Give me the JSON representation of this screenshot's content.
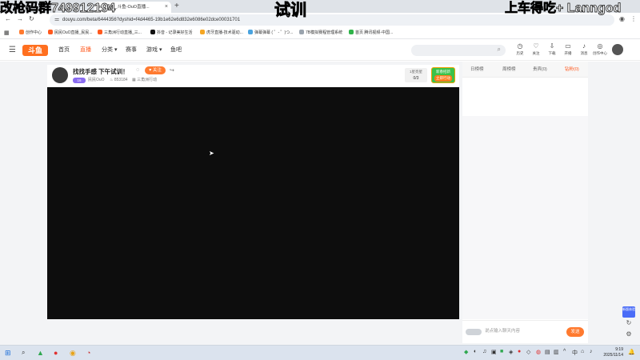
{
  "overlay": {
    "left_text": "改枪码群749912194",
    "center_text": "试训",
    "right_text": "上车得吃+ Lanngod"
  },
  "browser": {
    "active_tab_title": "iuO直播_斗鱼-OuO直播...",
    "new_tab_icon": "plus-icon",
    "url": "douyu.com/beta/6444356?dyshid=f4d4465-19b1e62e6d832e6086e02dce00031701",
    "bookmarks": [
      {
        "label": "创作中心",
        "color": "#ff7a2f"
      },
      {
        "label": "民民OuO直播_民民...",
        "color": "#ff5a1f"
      },
      {
        "label": "三角洲行动直播_三...",
        "color": "#ff5a1f"
      },
      {
        "label": "抖音 - 记录美好生活",
        "color": "#111111"
      },
      {
        "label": "虎牙直播-技术驱动...",
        "color": "#f5a623"
      },
      {
        "label": "弹幕弹幕 ( ゜- ゜)つ...",
        "color": "#4aa3df"
      },
      {
        "label": "7B模拟赛程管理系统",
        "color": "#9aa3ad"
      },
      {
        "label": "首页 腾讯视频-中国...",
        "color": "#2fb34a"
      }
    ]
  },
  "site": {
    "logo_text": "斗鱼",
    "nav": [
      {
        "label": "首页",
        "active": false
      },
      {
        "label": "直播",
        "active": true
      },
      {
        "label": "分类",
        "active": false
      },
      {
        "label": "赛事",
        "active": false
      },
      {
        "label": "游戏",
        "active": false
      },
      {
        "label": "鱼吧",
        "active": false
      }
    ],
    "header_icons": [
      {
        "icon": "clock-icon",
        "label": "历史"
      },
      {
        "icon": "heart-icon",
        "label": "关注"
      },
      {
        "icon": "download-icon",
        "label": "下载"
      },
      {
        "icon": "broadcast-icon",
        "label": "开播"
      },
      {
        "icon": "bell-icon",
        "label": "消息"
      },
      {
        "icon": "bulb-icon",
        "label": "创作中心"
      }
    ]
  },
  "room": {
    "title": "找找手感 下午试训！",
    "follow_label": "关注",
    "level_badge": "16",
    "streamer_name": "民民OuO",
    "heat": "853184",
    "category": "三角洲行动",
    "rank_top": "1星亮星",
    "rank_bottom": "0/3",
    "gift_top": "新春招新",
    "gift_bottom": "立即行动"
  },
  "chat": {
    "tabs": [
      {
        "label": "日榜榜",
        "active": false
      },
      {
        "label": "周榜榜",
        "active": false
      },
      {
        "label": "贵宾(0)",
        "active": false
      },
      {
        "label": "钻粉(0)",
        "active": true
      }
    ],
    "input_placeholder": "说点输入聊天内容",
    "send_label": "发送",
    "rail_tag": "新版体验"
  },
  "taskbar": {
    "time": "9:19",
    "date": "2025/11/14"
  },
  "colors": {
    "accent": "#ff5a1f",
    "follow": "#ff7a2f",
    "player": "#0d0d0d"
  }
}
